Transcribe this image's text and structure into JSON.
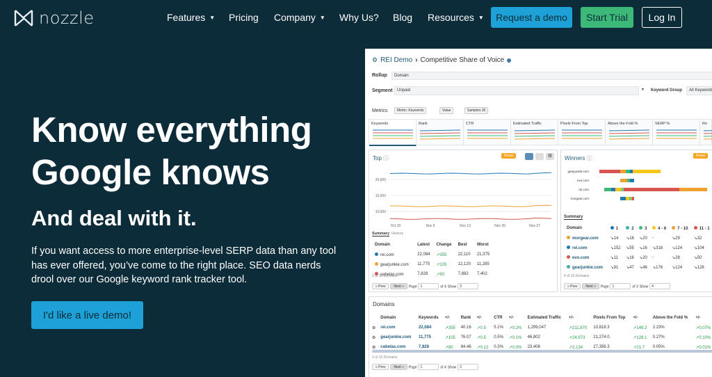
{
  "brand": {
    "name": "nozzle"
  },
  "nav": {
    "features": "Features",
    "pricing": "Pricing",
    "company": "Company",
    "why": "Why Us?",
    "blog": "Blog",
    "resources": "Resources",
    "demo": "Request a demo",
    "trial": "Start Trial",
    "login": "Log In",
    "colors": {
      "demo": "#1ea1d6",
      "trial": "#3cb878",
      "login_border": "#ffffff"
    }
  },
  "hero": {
    "title_line1": "Know everything",
    "title_line2": "Google knows",
    "subtitle": "And deal with it.",
    "paragraph": "If you want access to more enterprise-level SERP data than any tool has ever offered, you’ve come to the right place. SEO data nerds drool over our Google keyword rank tracker tool.",
    "cta": "I'd like a live demo!"
  },
  "app": {
    "breadcrumb1": "REI Demo",
    "breadcrumb2": "Competitive Share of Voice",
    "rollup_label": "Rollup",
    "rollup_value": "Domain",
    "segment_label": "Segment",
    "segment_value": "Unpaid",
    "kwgroup_label": "Keyword Group",
    "kwgroup_value": "All Keywords",
    "metrics_label": "Metrics",
    "metric_chip": "Metric: Keywords",
    "value_chip": "Value",
    "samples_label": "Samples",
    "samples_value": "30",
    "metric_tabs": [
      "Keywords",
      "Rank",
      "CTR",
      "Estimated Traffic",
      "Pixels From Top",
      "Above the Fold %",
      "SERP %",
      "Re"
    ],
    "top": {
      "title": "Top",
      "reset": "Reset",
      "yticks": [
        "20,000",
        "15,000",
        "10,000"
      ],
      "xticks": [
        "Oct 30",
        "Nov 6",
        "Nov 13",
        "Nov 20",
        "Nov 27"
      ],
      "tab_summary": "Summary",
      "tab_history": "History",
      "headers": [
        "Domain",
        "Latest",
        "Change",
        "Best",
        "Worst"
      ],
      "rows": [
        {
          "domain": "rei.com",
          "latest": "22,084",
          "change": "355",
          "best": "22,110",
          "worst": "21,375",
          "color": "#1f77b4"
        },
        {
          "domain": "gearjunkie.com",
          "latest": "11,775",
          "change": "105",
          "best": "12,120",
          "worst": "11,285",
          "color": "#f0a030"
        },
        {
          "domain": "cabelas.com",
          "latest": "7,828",
          "change": "80",
          "best": "7,882",
          "worst": "7,402",
          "color": "#d9534f"
        }
      ],
      "footer": "3 of 10 Domains",
      "prev": "Prev",
      "next": "Next",
      "page": "Page",
      "page_val": "1",
      "of": "of 4",
      "show": "Show",
      "show_val": "3"
    },
    "winners": {
      "title": "Winners",
      "reset": "Reset",
      "bar_labels": [
        "gearjunkie.com",
        "evo.com",
        "rei.com",
        "morgear.com"
      ],
      "summary": "Summary",
      "headers": [
        "Domain",
        "1",
        "2",
        "3",
        "4 - 6",
        "7 - 10",
        "11 - 1"
      ],
      "rows": [
        {
          "domain": "morgear.com",
          "c1": "14",
          "c2": "16",
          "c3": "20",
          "c4": "-",
          "c5": "29",
          "c6": "32",
          "color": "#f0a030"
        },
        {
          "domain": "rei.com",
          "c1": "152",
          "c2": "55",
          "c3": "16",
          "c4": "318",
          "c5": "124",
          "c6": "104",
          "color": "#1f77b4"
        },
        {
          "domain": "evo.com",
          "c1": "11",
          "c2": "16",
          "c3": "20",
          "c4": "-",
          "c5": "28",
          "c6": "50",
          "color": "#d9534f"
        },
        {
          "domain": "gearjunkie.com",
          "c1": "91",
          "c2": "47",
          "c3": "46",
          "c4": "176",
          "c5": "124",
          "c6": "128",
          "color": "#3bb3a0"
        }
      ],
      "footer": "4 of 10 Domains",
      "of": "of 3",
      "show_val": "4"
    },
    "domains": {
      "title": "Domains",
      "headers": [
        "Domain",
        "Keywords",
        "+/-",
        "Rank",
        "+/-",
        "CTR",
        "+/-",
        "Estimated Traffic",
        "+/-",
        "Pixels From Top",
        "+/-",
        "Above the Fold %",
        "+/-"
      ],
      "rows": [
        {
          "domain": "rei.com",
          "kw": "22,084",
          "kwd": "355",
          "rank": "40.16",
          "rankd": "0.5",
          "ctr": "5.1%",
          "ctrd": "0.2%",
          "traffic": "1,299,047",
          "trafficd": "211,870",
          "pix": "10,818.3",
          "pixd": "149.2",
          "atf": "2.23%",
          "atfd": "0.07%"
        },
        {
          "domain": "gearjunkie.com",
          "kw": "11,775",
          "kwd": "105",
          "rank": "76.07",
          "rankd": "0.5",
          "ctr": "0.5%",
          "ctrd": "0.1%",
          "traffic": "46,802",
          "trafficd": "24,973",
          "pix": "21,274.0",
          "pixd": "128.1",
          "atf": "0.27%",
          "atfd": "0.10%"
        },
        {
          "domain": "cabelas.com",
          "kw": "7,828",
          "kwd": "80",
          "rank": "84.46",
          "rankd": "0.12",
          "ctr": "0.3%",
          "ctrd": "0.0%",
          "traffic": "23,406",
          "trafficd": "2,134",
          "pix": "27,356.3",
          "pixd": "21.7",
          "atf": "0.05%",
          "atfd": "0.01%"
        }
      ],
      "footer": "3 of 10 Domains",
      "of": "of 4",
      "show_val": "3"
    }
  }
}
